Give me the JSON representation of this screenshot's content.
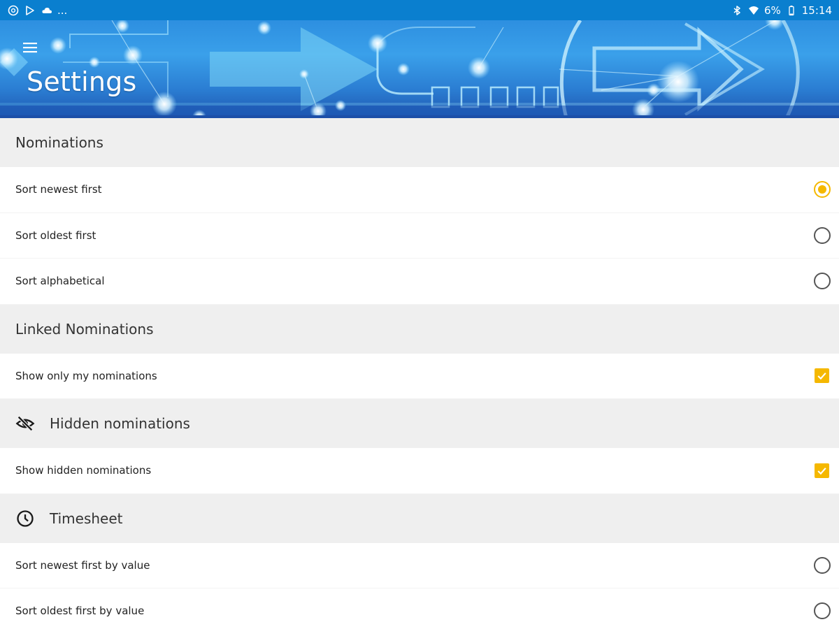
{
  "status_bar": {
    "left_icons": [
      "vpn-icon",
      "play-store-icon",
      "cloud-icon"
    ],
    "ellipsis": "...",
    "right_icons": [
      "bluetooth-icon",
      "wifi-icon"
    ],
    "battery": "6%",
    "time": "15:14"
  },
  "header": {
    "title": "Settings",
    "menu_icon": "hamburger-menu-icon"
  },
  "colors": {
    "accent": "#f5b800",
    "status_bar": "#0a7fcf",
    "section_bg": "#efefef"
  },
  "sections": {
    "nominations": {
      "title": "Nominations",
      "options": [
        {
          "label": "Sort newest first",
          "selected": true
        },
        {
          "label": "Sort oldest first",
          "selected": false
        },
        {
          "label": "Sort alphabetical",
          "selected": false
        }
      ]
    },
    "linked": {
      "title": "Linked Nominations",
      "options": [
        {
          "label": "Show only my nominations",
          "checked": true
        }
      ]
    },
    "hidden": {
      "title": "Hidden nominations",
      "icon": "eye-off-icon",
      "options": [
        {
          "label": "Show hidden nominations",
          "checked": true
        }
      ]
    },
    "timesheet": {
      "title": "Timesheet",
      "icon": "clock-icon",
      "options": [
        {
          "label": "Sort newest first by value",
          "selected": false
        },
        {
          "label": "Sort oldest first by value",
          "selected": false
        }
      ]
    }
  }
}
